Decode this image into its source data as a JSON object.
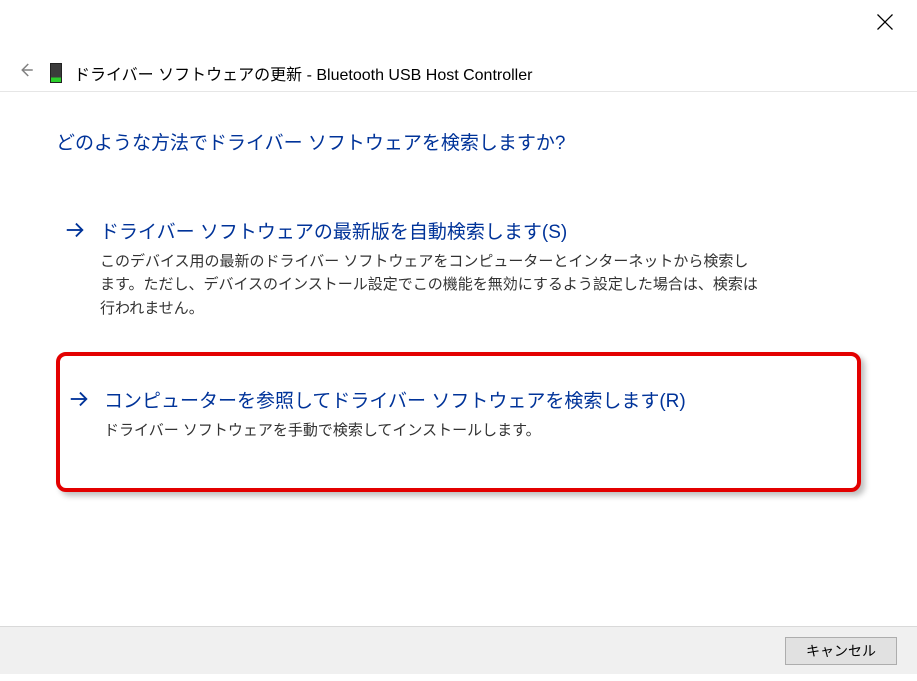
{
  "title_prefix": "ドライバー ソフトウェアの更新 - ",
  "device_name": "Bluetooth USB Host Controller",
  "heading": "どのような方法でドライバー ソフトウェアを検索しますか?",
  "options": [
    {
      "title": "ドライバー ソフトウェアの最新版を自動検索します(S)",
      "desc": "このデバイス用の最新のドライバー ソフトウェアをコンピューターとインターネットから検索します。ただし、デバイスのインストール設定でこの機能を無効にするよう設定した場合は、検索は行われません。"
    },
    {
      "title": "コンピューターを参照してドライバー ソフトウェアを検索します(R)",
      "desc": "ドライバー ソフトウェアを手動で検索してインストールします。"
    }
  ],
  "footer": {
    "cancel_label": "キャンセル"
  }
}
